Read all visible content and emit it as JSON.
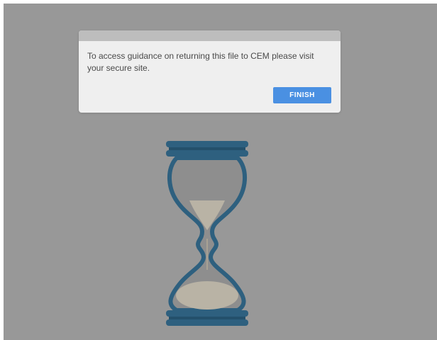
{
  "dialog": {
    "message": "To access guidance on returning this file to CEM please visit your secure site.",
    "finish_label": "FINISH"
  },
  "loading": {
    "icon": "hourglass-icon"
  },
  "colors": {
    "overlay": "#989898",
    "dialog_background": "#efefef",
    "dialog_titlebar": "#bdbdbd",
    "button": "#4a90e2",
    "hourglass_frame": "#2e607f",
    "sand": "#b9b3a5"
  }
}
